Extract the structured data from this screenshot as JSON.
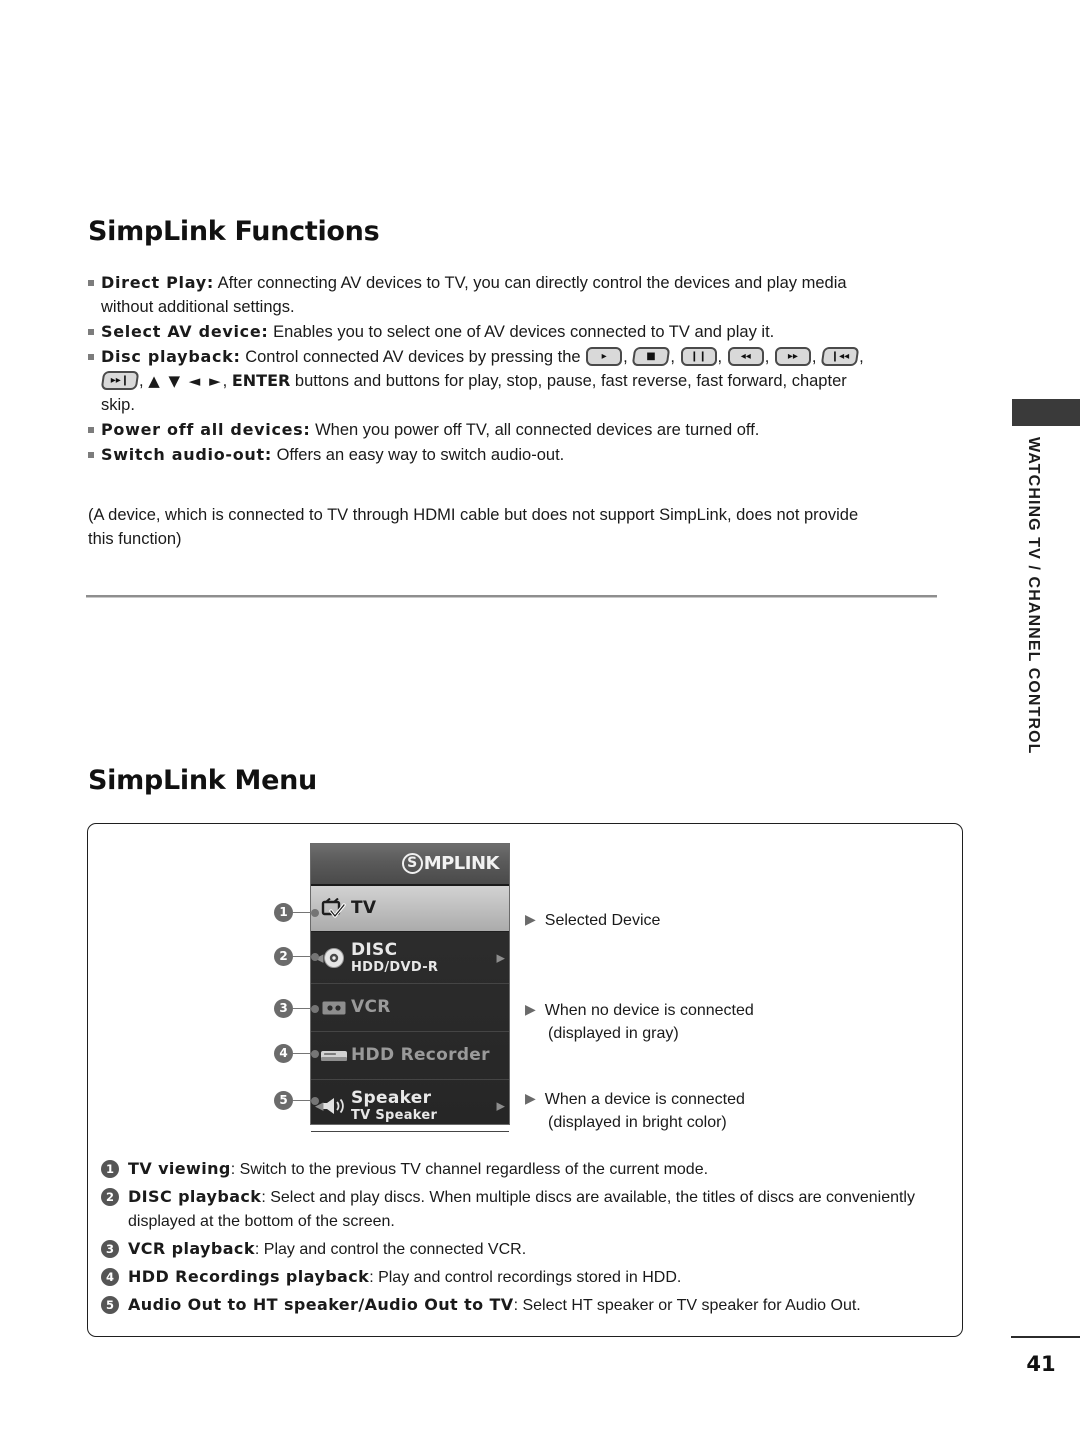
{
  "headings": {
    "functions": "SimpLink Functions",
    "menu": "SimpLink Menu"
  },
  "bullets": [
    {
      "term": "Direct Play:",
      "text": "After connecting AV devices to TV, you can directly control the devices and play media without additional settings."
    },
    {
      "term": "Select AV device:",
      "text": "Enables you to select one of AV devices connected to TV and play it."
    },
    {
      "term": "Disc playback:",
      "text_before_keys": "Control connected AV devices by pressing the",
      "text_after_keys": "buttons and buttons for play, stop, pause, fast reverse, fast forward, chapter skip.",
      "keys": [
        "play",
        "stop",
        "pause",
        "fast-reverse",
        "fast-forward",
        "skip-back",
        "skip-forward"
      ],
      "arrows": "▲ ▼ ◄ ►",
      "enter": "ENTER"
    },
    {
      "term": "Power off all devices:",
      "text": "When you power off TV, all connected devices are turned off."
    },
    {
      "term": "Switch audio-out:",
      "text": "Offers an easy way to switch audio-out."
    }
  ],
  "note": "(A device, which is connected to TV through HDMI cable but does not support SimpLink, does not provide this function)",
  "side_title": "WATCHING TV / CHANNEL CONTROL",
  "osd": {
    "logo_mark": "S",
    "logo_text": "MPLINK",
    "rows": [
      {
        "label": "TV",
        "sub": "",
        "state": "selected",
        "icon": "tv-check-icon",
        "arrows": false
      },
      {
        "label": "DISC",
        "sub": "HDD/DVD-R",
        "state": "bright",
        "icon": "disc-icon",
        "arrows": true
      },
      {
        "label": "VCR",
        "sub": "",
        "state": "gray",
        "icon": "vcr-icon",
        "arrows": false
      },
      {
        "label": "HDD Recorder",
        "sub": "",
        "state": "gray",
        "icon": "hdd-recorder-icon",
        "arrows": false
      },
      {
        "label": "Speaker",
        "sub": "TV Speaker",
        "state": "bright",
        "icon": "speaker-icon",
        "arrows": true
      }
    ]
  },
  "annotations": [
    {
      "text": "Selected  Device"
    },
    {
      "text": "When no device is connected"
    },
    {
      "text": "(displayed in gray)"
    },
    {
      "text": "When a device is connected"
    },
    {
      "text": "(displayed in bright color)"
    }
  ],
  "numbered_list": [
    {
      "num": "1",
      "term": "TV viewing",
      "text": ": Switch to the previous TV channel regardless of the current mode."
    },
    {
      "num": "2",
      "term": "DISC playback",
      "text": ": Select and play discs. When multiple discs are available, the titles of discs are conveniently displayed at the bottom of the screen."
    },
    {
      "num": "3",
      "term": "VCR playback",
      "text": ": Play and control the connected VCR."
    },
    {
      "num": "4",
      "term": "HDD Recordings playback",
      "text": ": Play and control recordings stored in HDD."
    },
    {
      "num": "5",
      "term": "Audio Out to HT speaker/Audio Out to TV",
      "text": ": Select HT speaker or TV speaker for Audio Out."
    }
  ],
  "callout_numbers": [
    "1",
    "2",
    "3",
    "4",
    "5"
  ],
  "page_number": "41",
  "colors": {
    "text": "#1a1a1a",
    "bullet": "#7c7c7c",
    "rule": "#8e8e8e",
    "osd_selected": "#c4c4c4",
    "osd_bg": "#2e2e2e",
    "tab": "#3a3a3a"
  }
}
